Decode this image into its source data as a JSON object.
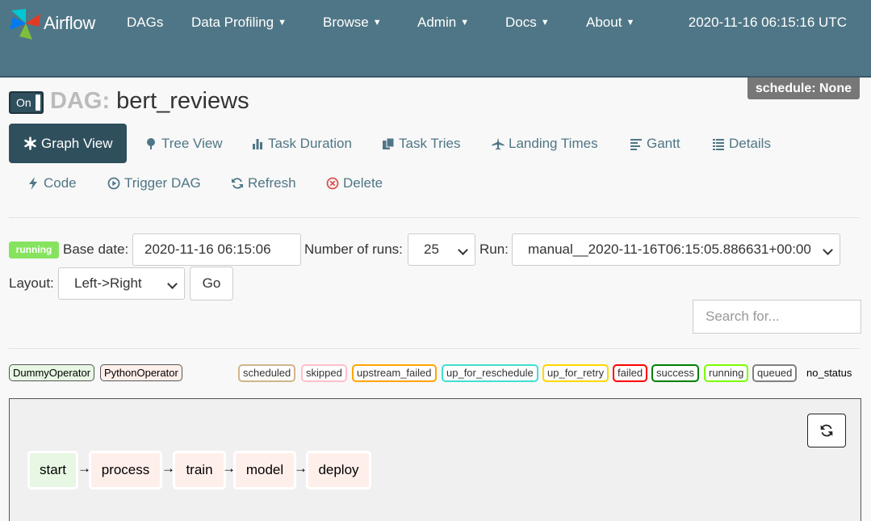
{
  "navbar": {
    "brand": "Airflow",
    "items": [
      {
        "label": "DAGs",
        "caret": false
      },
      {
        "label": "Data Profiling",
        "caret": true
      },
      {
        "label": "Browse",
        "caret": true
      },
      {
        "label": "Admin",
        "caret": true
      },
      {
        "label": "Docs",
        "caret": true
      },
      {
        "label": "About",
        "caret": true
      }
    ],
    "clock": "2020-11-16 06:15:16 UTC"
  },
  "dag": {
    "toggle_label": "On",
    "prefix": "DAG:",
    "id": "bert_reviews",
    "schedule": "schedule: None"
  },
  "tabs": {
    "graph_view": "Graph View",
    "tree_view": "Tree View",
    "task_duration": "Task Duration",
    "task_tries": "Task Tries",
    "landing_times": "Landing Times",
    "gantt": "Gantt",
    "details": "Details",
    "code": "Code",
    "trigger_dag": "Trigger DAG",
    "refresh": "Refresh",
    "delete": "Delete"
  },
  "form": {
    "state_badge": "running",
    "base_date_label": "Base date:",
    "base_date_value": "2020-11-16 06:15:06",
    "num_runs_label": "Number of runs:",
    "num_runs_value": "25",
    "run_label": "Run:",
    "run_value": "manual__2020-11-16T06:15:05.886631+00:00",
    "layout_label": "Layout:",
    "layout_value": "Left->Right",
    "go_label": "Go",
    "search_placeholder": "Search for..."
  },
  "legend": {
    "operators": [
      {
        "label": "DummyOperator",
        "color": "#e8f7e4"
      },
      {
        "label": "PythonOperator",
        "color": "#ffefeb"
      }
    ],
    "states": [
      {
        "label": "scheduled",
        "color": "#d2b48c"
      },
      {
        "label": "skipped",
        "color": "#ffc0cb"
      },
      {
        "label": "upstream_failed",
        "color": "#ffa500"
      },
      {
        "label": "up_for_reschedule",
        "color": "#40e0d0"
      },
      {
        "label": "up_for_retry",
        "color": "#ffd700"
      },
      {
        "label": "failed",
        "color": "#ff0000"
      },
      {
        "label": "success",
        "color": "#008000"
      },
      {
        "label": "running",
        "color": "#7cfc00"
      },
      {
        "label": "queued",
        "color": "#808080"
      }
    ],
    "no_status": "no_status"
  },
  "graph": {
    "nodes": [
      {
        "label": "start",
        "color": "#e8f7e4"
      },
      {
        "label": "process",
        "color": "#ffefeb"
      },
      {
        "label": "train",
        "color": "#ffefeb"
      },
      {
        "label": "model",
        "color": "#ffefeb"
      },
      {
        "label": "deploy",
        "color": "#ffefeb"
      }
    ],
    "arrow": "→",
    "refresh_icon": "refresh-icon"
  }
}
